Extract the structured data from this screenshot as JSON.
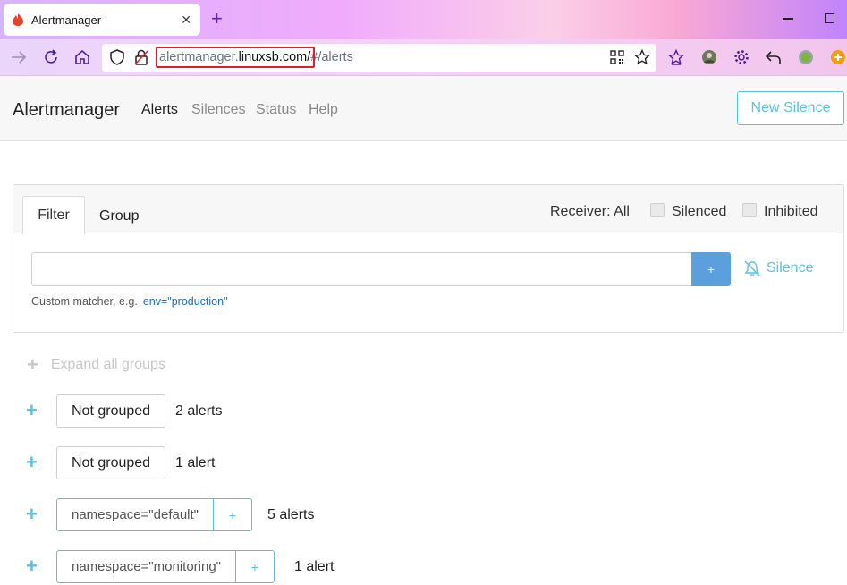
{
  "browser": {
    "tab_title": "Alertmanager",
    "tab_close": "✕",
    "new_tab": "+",
    "url_domain_prefix": "alertmanager.",
    "url_domain_main": "linuxsb.com",
    "url_slash": "/",
    "url_path": "#/alerts"
  },
  "app": {
    "brand": "Alertmanager",
    "nav": [
      "Alerts",
      "Silences",
      "Status",
      "Help"
    ],
    "new_silence": "New Silence"
  },
  "filter": {
    "tab_filter": "Filter",
    "tab_group": "Group",
    "receiver": "Receiver: All",
    "silenced": "Silenced",
    "inhibited": "Inhibited",
    "input_value": "",
    "add_label": "+",
    "silence_link": "Silence",
    "hint_text": "Custom matcher, e.g.",
    "hint_code": "env=\"production\""
  },
  "groups": {
    "expand_all": "Expand all groups",
    "plus": "+",
    "items": [
      {
        "label": "Not grouped",
        "count": "2 alerts"
      },
      {
        "label": "Not grouped",
        "count": "1 alert"
      },
      {
        "label": "namespace=\"default\"",
        "count": "5 alerts"
      },
      {
        "label": "namespace=\"monitoring\"",
        "count": "1 alert"
      }
    ]
  },
  "colors": {
    "accent": "#5bc0de",
    "primary_button": "#5b9fdd",
    "url_highlight": "#e11d2a"
  },
  "icons": [
    "firefox-favicon",
    "forward-icon",
    "reload-icon",
    "home-icon",
    "shield-icon",
    "lock-icon",
    "qr-code-icon",
    "bookmark-star-icon",
    "extension-star-icon",
    "avatar",
    "gear-icon",
    "undo-icon",
    "green-dot-icon",
    "extension-icon",
    "bell-slash-icon"
  ]
}
